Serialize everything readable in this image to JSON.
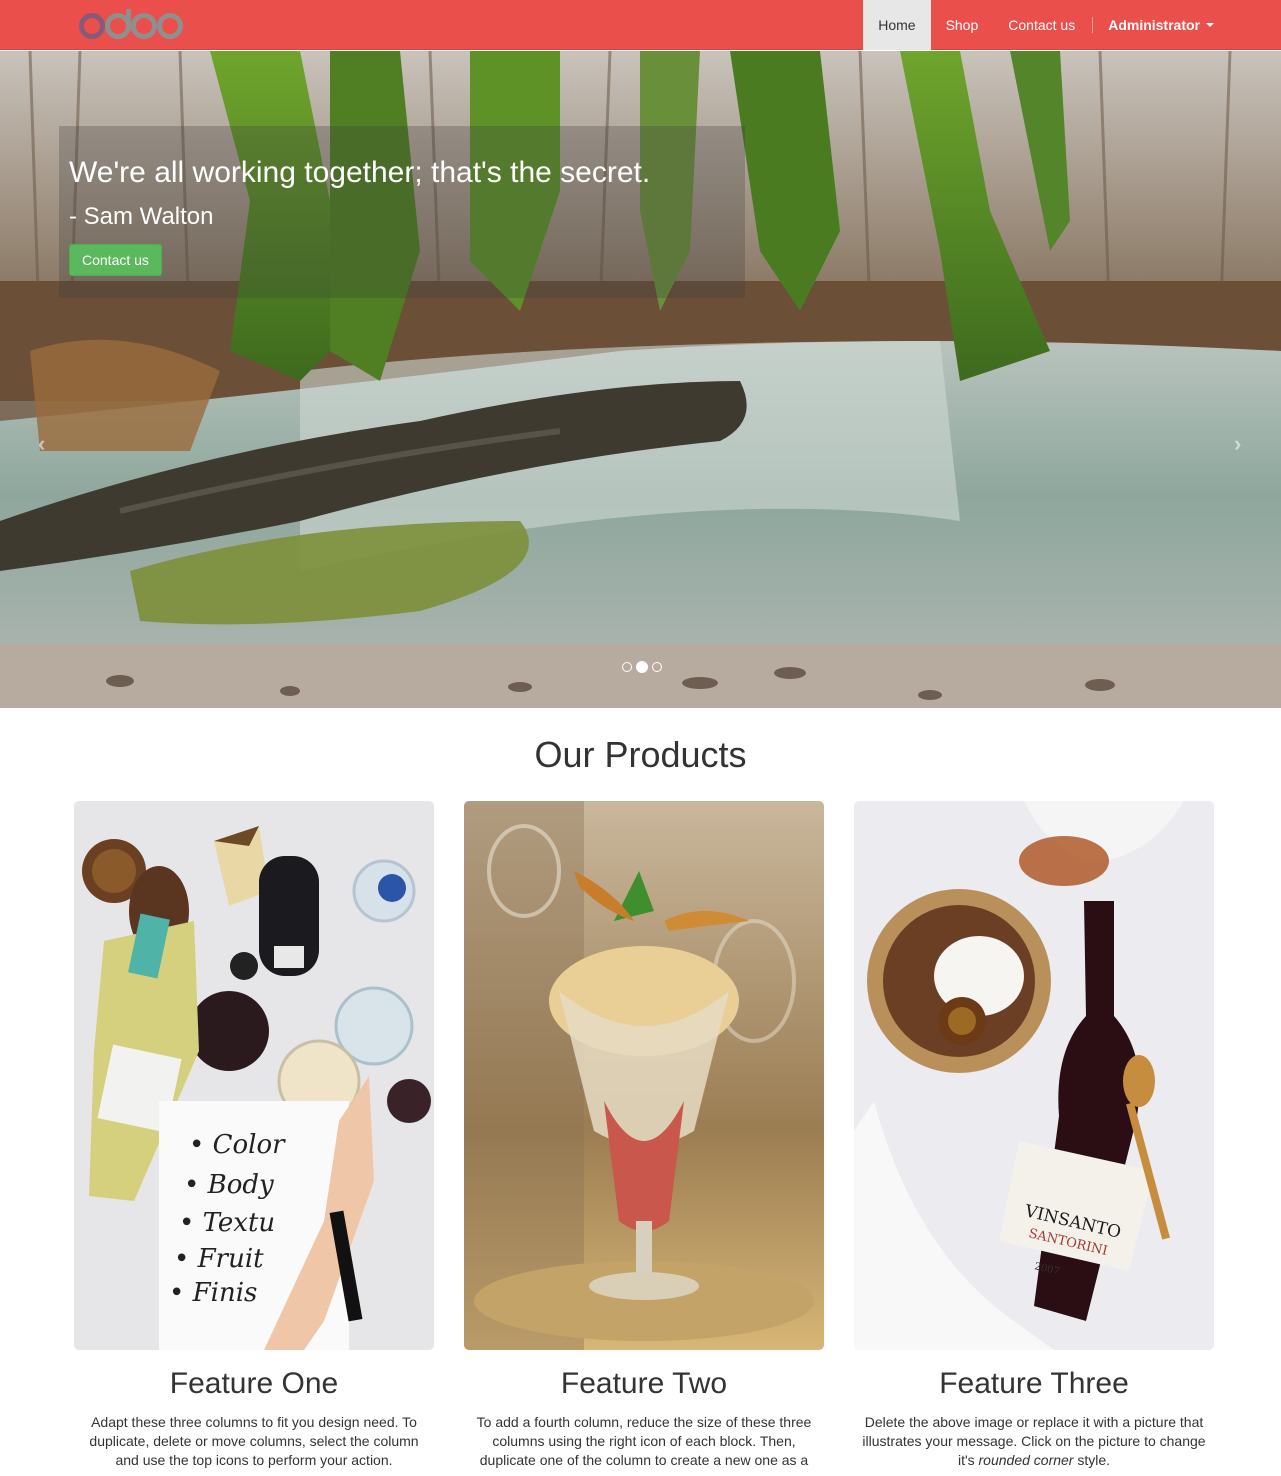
{
  "brand": {
    "logo_text": "odoo",
    "logo_colors": [
      "#875a7b",
      "#8f8f8f"
    ]
  },
  "navbar": {
    "background": "#ea4f4c",
    "items": [
      {
        "label": "Home",
        "active": true
      },
      {
        "label": "Shop",
        "active": false
      },
      {
        "label": "Contact us",
        "active": false
      }
    ],
    "user_menu": {
      "label": "Administrator",
      "icon": "caret-down-icon"
    }
  },
  "hero": {
    "quote": "We're all working together; that's the secret.",
    "author": "- Sam Walton",
    "cta_label": "Contact us",
    "prev_icon": "chevron-left-icon",
    "next_icon": "chevron-right-icon",
    "slide_count": 3,
    "active_slide": 2,
    "image_subject": "mossy forest stream"
  },
  "products": {
    "title": "Our Products",
    "features": [
      {
        "title": "Feature One",
        "text": "Adapt these three columns to fit you design need. To duplicate, delete or move columns, select the column and use the top icons to perform your action.",
        "image_subject": "wine tasting flat lay"
      },
      {
        "title": "Feature Two",
        "text": "To add a fourth column, reduce the size of these three columns using the right icon of each block. Then, duplicate one of the column to create a new one as a copy.",
        "image_subject": "ice cream sundae glass"
      },
      {
        "title": "Feature Three",
        "text_before": "Delete the above image or replace it with a picture that illustrates your message. Click on the picture to change it's ",
        "text_em": "rounded corner",
        "text_after": " style.",
        "image_subject": "granola bowl and vinsanto bottle",
        "bottle_label": "VINSANTO",
        "bottle_sublabel": "SANTORINI",
        "bottle_year": "2007"
      }
    ]
  },
  "colors": {
    "success": "#5cb85c",
    "accent": "#ea4f4c"
  }
}
